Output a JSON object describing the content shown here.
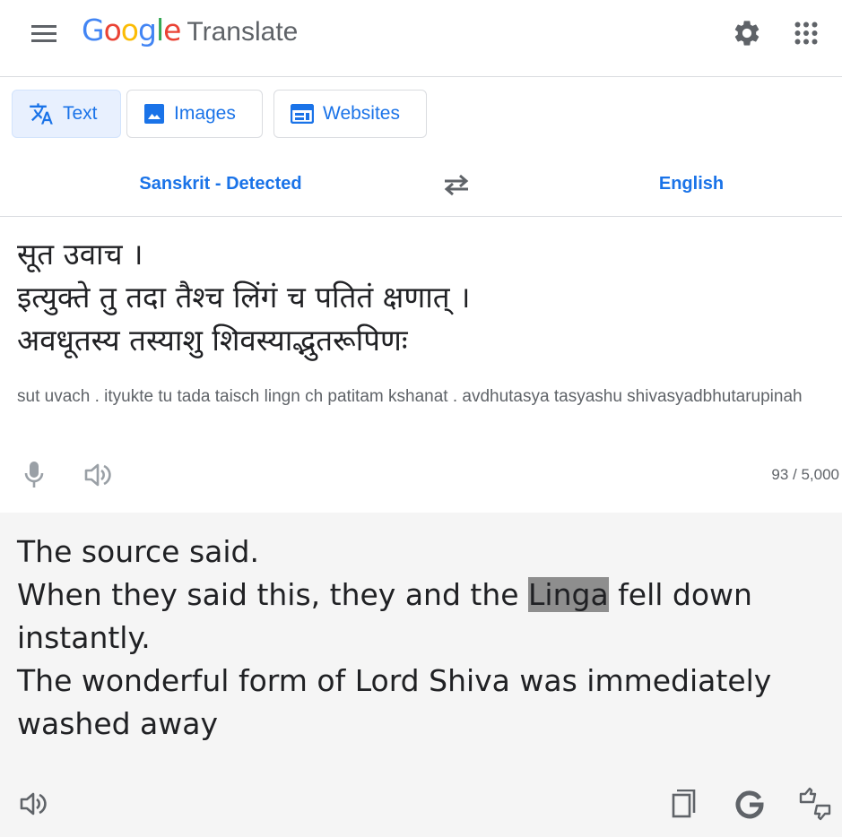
{
  "header": {
    "logo_letters": [
      {
        "ch": "G",
        "color": "#4285F4"
      },
      {
        "ch": "o",
        "color": "#EA4335"
      },
      {
        "ch": "o",
        "color": "#FBBC05"
      },
      {
        "ch": "g",
        "color": "#4285F4"
      },
      {
        "ch": "l",
        "color": "#34A853"
      },
      {
        "ch": "e",
        "color": "#EA4335"
      }
    ],
    "product_name": "Translate",
    "icons": {
      "menu": "hamburger-menu-icon",
      "settings": "gear-icon",
      "apps": "apps-grid-icon"
    }
  },
  "modes": [
    {
      "label": "Text",
      "icon": "translate-icon",
      "active": true
    },
    {
      "label": "Images",
      "icon": "image-icon",
      "active": false
    },
    {
      "label": "Websites",
      "icon": "website-icon",
      "active": false
    }
  ],
  "languages": {
    "source": "Sanskrit - Detected",
    "target": "English",
    "swap_icon": "swap-arrows-icon"
  },
  "source": {
    "text": "सूत उवाच ।\nइत्युक्ते तु तदा तैश्च लिंगं च पतितं क्षणात् ।\nअवधूतस्य तस्याशु शिवस्याद्भुतरूपिणः",
    "transliteration": "sut uvach . ityukte tu tada taisch lingn ch patitam kshanat . avdhutasya tasyashu shivasyadbhutarupinah",
    "char_count": "93 / 5,000",
    "icons": {
      "mic": "microphone-icon",
      "listen": "speaker-icon"
    }
  },
  "target": {
    "line1": "The source said.",
    "line2_before": "When they said this, they and the ",
    "line2_highlight": "Linga",
    "line2_after": " fell down instantly.",
    "line3": "The wonderful form of Lord Shiva was immediately washed away",
    "icons": {
      "listen": "speaker-icon",
      "copy": "copy-icon",
      "google": "google-g-icon",
      "rate": "rate-translation-icon"
    }
  },
  "colors": {
    "accent": "#1a73e8",
    "icon_grey": "#5f6368",
    "target_bg": "#f5f5f5",
    "active_tab_bg": "#e8f0fe",
    "highlight": "#8e8e8e"
  }
}
